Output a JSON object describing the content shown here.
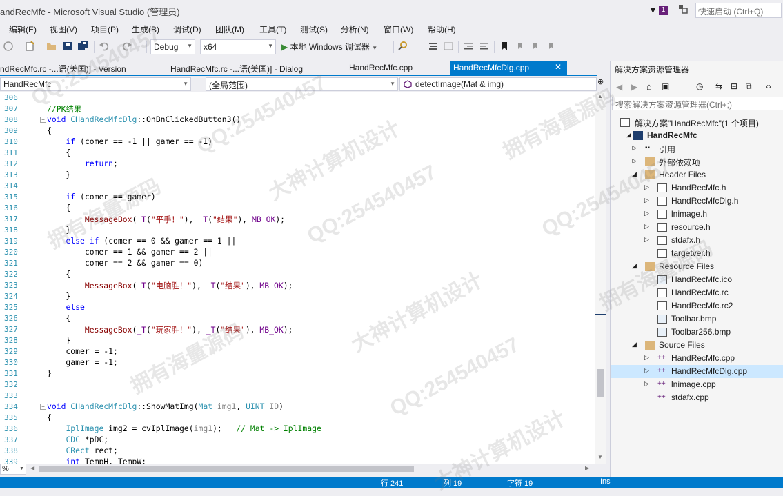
{
  "window": {
    "title": "andRecMfc - Microsoft Visual Studio (管理员)",
    "notification_count": "1",
    "quick_launch_placeholder": "快速启动 (Ctrl+Q)"
  },
  "menu": [
    "编辑(E)",
    "视图(V)",
    "项目(P)",
    "生成(B)",
    "调试(D)",
    "团队(M)",
    "工具(T)",
    "测试(S)",
    "分析(N)",
    "窗口(W)",
    "帮助(H)"
  ],
  "toolbar": {
    "config": "Debug",
    "platform": "x64",
    "run_label": "本地 Windows 调试器"
  },
  "tabs": [
    {
      "label": "ndRecMfc.rc -...语(美国)] - Version"
    },
    {
      "label": "HandRecMfc.rc -...语(美国)] - Dialog"
    },
    {
      "label": "HandRecMfc.cpp"
    },
    {
      "label": "HandRecMfcDlg.cpp"
    }
  ],
  "navbar": {
    "project": "HandRecMfc",
    "scope": "(全局范围)",
    "member": "detectImage(Mat & img)"
  },
  "editor": {
    "zoom": "%",
    "lines": [
      {
        "n": "306",
        "text": ""
      },
      {
        "n": "307",
        "text": "//PK结果"
      },
      {
        "n": "308",
        "text": "void CHandRecMfcDlg::OnBnClickedButton3()"
      },
      {
        "n": "309",
        "text": "{"
      },
      {
        "n": "310",
        "text": "    if (comer == -1 || gamer == -1)"
      },
      {
        "n": "311",
        "text": "    {"
      },
      {
        "n": "312",
        "text": "        return;"
      },
      {
        "n": "313",
        "text": "    }"
      },
      {
        "n": "314",
        "text": ""
      },
      {
        "n": "315",
        "text": "    if (comer == gamer)"
      },
      {
        "n": "316",
        "text": "    {"
      },
      {
        "n": "317",
        "text": "        MessageBox(_T(\"平手！\"), _T(\"结果\"), MB_OK);"
      },
      {
        "n": "318",
        "text": "    }"
      },
      {
        "n": "319",
        "text": "    else if (comer == 0 && gamer == 1 ||"
      },
      {
        "n": "320",
        "text": "        comer == 1 && gamer == 2 ||"
      },
      {
        "n": "321",
        "text": "        comer == 2 && gamer == 0)"
      },
      {
        "n": "322",
        "text": "    {"
      },
      {
        "n": "323",
        "text": "        MessageBox(_T(\"电脑胜！\"), _T(\"结果\"), MB_OK);"
      },
      {
        "n": "324",
        "text": "    }"
      },
      {
        "n": "325",
        "text": "    else"
      },
      {
        "n": "326",
        "text": "    {"
      },
      {
        "n": "327",
        "text": "        MessageBox(_T(\"玩家胜！\"), _T(\"结果\"), MB_OK);"
      },
      {
        "n": "328",
        "text": "    }"
      },
      {
        "n": "329",
        "text": "    comer = -1;"
      },
      {
        "n": "330",
        "text": "    gamer = -1;"
      },
      {
        "n": "331",
        "text": "}"
      },
      {
        "n": "332",
        "text": ""
      },
      {
        "n": "333",
        "text": ""
      },
      {
        "n": "334",
        "text": "void CHandRecMfcDlg::ShowMatImg(Mat img1, UINT ID)"
      },
      {
        "n": "335",
        "text": "{"
      },
      {
        "n": "336",
        "text": "    IplImage img2 = cvIplImage(img1);   // Mat -> IplImage"
      },
      {
        "n": "337",
        "text": "    CDC *pDC;"
      },
      {
        "n": "338",
        "text": "    CRect rect;"
      },
      {
        "n": "339",
        "text": "    int TempH, TempW;"
      }
    ]
  },
  "solution_explorer": {
    "title": "解决方案资源管理器",
    "search_placeholder": "搜索解决方案资源管理器(Ctrl+;)",
    "nodes": [
      {
        "label": "解决方案\"HandRecMfc\"(1 个项目)"
      },
      {
        "label": "HandRecMfc"
      },
      {
        "label": "引用"
      },
      {
        "label": "外部依赖项"
      },
      {
        "label": "Header Files"
      },
      {
        "label": "HandRecMfc.h"
      },
      {
        "label": "HandRecMfcDlg.h"
      },
      {
        "label": "lnimage.h"
      },
      {
        "label": "resource.h"
      },
      {
        "label": "stdafx.h"
      },
      {
        "label": "targetver.h"
      },
      {
        "label": "Resource Files"
      },
      {
        "label": "HandRecMfc.ico"
      },
      {
        "label": "HandRecMfc.rc"
      },
      {
        "label": "HandRecMfc.rc2"
      },
      {
        "label": "Toolbar.bmp"
      },
      {
        "label": "Toolbar256.bmp"
      },
      {
        "label": "Source Files"
      },
      {
        "label": "HandRecMfc.cpp"
      },
      {
        "label": "HandRecMfcDlg.cpp"
      },
      {
        "label": "lnimage.cpp"
      },
      {
        "label": "stdafx.cpp"
      }
    ]
  },
  "statusbar": {
    "line": "行 241",
    "col": "列 19",
    "ch": "字符 19",
    "mode": "Ins"
  },
  "watermarks": {
    "qq": "QQ:254540457",
    "a": "拥有海量源码",
    "b": "大神计算机设计"
  },
  "colors": {
    "accent": "#007ACC",
    "selection": "#CCE8FF"
  }
}
